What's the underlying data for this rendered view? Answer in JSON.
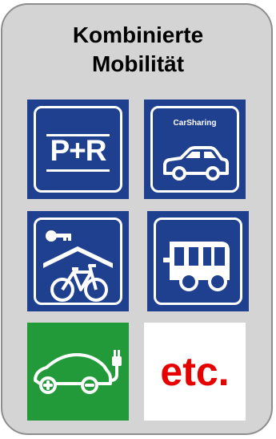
{
  "title": {
    "line1": "Kombinierte",
    "line2": "Mobilität"
  },
  "tiles": {
    "park_and_ride": {
      "label": "P+R"
    },
    "carsharing": {
      "label": "CarSharing"
    },
    "etc": {
      "label": "etc."
    }
  },
  "colors": {
    "panel": "#d4d4d4",
    "panel_border": "#8d8d8d",
    "sign_blue": "#1f3f8f",
    "ev_green": "#229a3a",
    "etc_red": "#e60000"
  },
  "icons": [
    "car-icon",
    "key-icon",
    "house-roof-icon",
    "bicycle-icon",
    "bus-icon",
    "electric-car-icon",
    "plug-icon"
  ]
}
